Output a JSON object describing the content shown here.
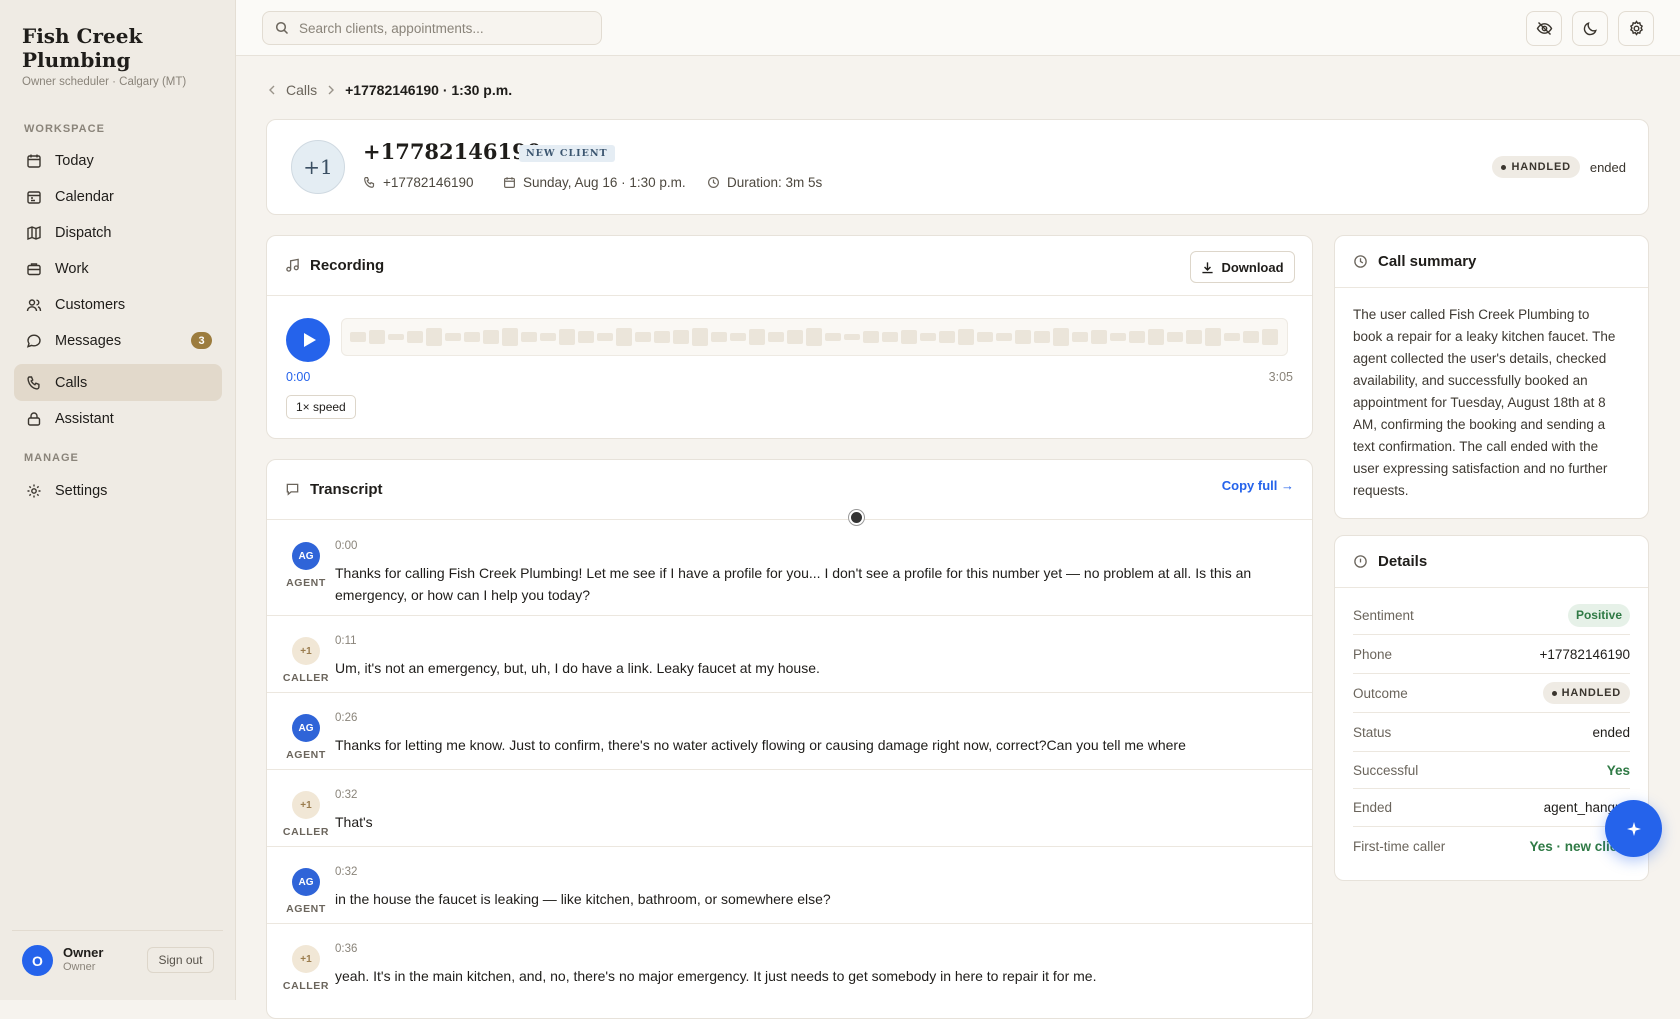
{
  "brand": {
    "name": "Fish Creek Plumbing",
    "subtitle": "Owner scheduler · Calgary (MT)"
  },
  "sidebar": {
    "workspace_label": "WORKSPACE",
    "manage_label": "MANAGE",
    "items": [
      {
        "label": "Today",
        "icon": "calendar-day-icon"
      },
      {
        "label": "Calendar",
        "icon": "calendar-icon"
      },
      {
        "label": "Dispatch",
        "icon": "map-icon"
      },
      {
        "label": "Work",
        "icon": "briefcase-icon"
      },
      {
        "label": "Customers",
        "icon": "users-icon"
      },
      {
        "label": "Messages",
        "icon": "message-icon",
        "badge": "3"
      },
      {
        "label": "Calls",
        "icon": "phone-icon",
        "active": true
      },
      {
        "label": "Assistant",
        "icon": "lock-icon"
      }
    ],
    "manage_items": [
      {
        "label": "Settings",
        "icon": "gear-icon"
      }
    ],
    "user": {
      "initial": "O",
      "name": "Owner",
      "role": "Owner",
      "signout": "Sign out"
    }
  },
  "topbar": {
    "search_placeholder": "Search clients, appointments..."
  },
  "breadcrumb": {
    "parent": "Calls",
    "current": "+17782146190 · 1:30 p.m."
  },
  "call": {
    "avatar": "+1",
    "number": "+17782146190",
    "badge": "NEW CLIENT",
    "phone": "+17782146190",
    "date": "Sunday, Aug 16 · 1:30 p.m.",
    "duration": "Duration: 3m 5s",
    "outcome": "HANDLED",
    "status": "ended"
  },
  "recording": {
    "title": "Recording",
    "download": "Download",
    "current_time": "0:00",
    "total_time": "3:05",
    "speed": "1× speed",
    "progress": 0
  },
  "transcript": {
    "title": "Transcript",
    "copy_label": "Copy full →",
    "turns": [
      {
        "role": "AGENT",
        "initials": "AG",
        "time": "0:00",
        "text": "Thanks for calling Fish Creek Plumbing! Let me see if I have a profile for you... I don't see a profile for this number yet — no problem at all. Is this an emergency, or how can I help you today?"
      },
      {
        "role": "CALLER",
        "initials": "+1",
        "time": "0:11",
        "text": "Um, it's not an emergency, but, uh, I do have a link. Leaky faucet at my house."
      },
      {
        "role": "AGENT",
        "initials": "AG",
        "time": "0:26",
        "text": "Thanks for letting me know. Just to confirm, there's no water actively flowing or causing damage right now, correct?Can you tell me where"
      },
      {
        "role": "CALLER",
        "initials": "+1",
        "time": "0:32",
        "text": "That's"
      },
      {
        "role": "AGENT",
        "initials": "AG",
        "time": "0:32",
        "text": "in the house the faucet is leaking — like kitchen, bathroom, or somewhere else?"
      },
      {
        "role": "CALLER",
        "initials": "+1",
        "time": "0:36",
        "text": "yeah. It's in the main kitchen, and, no, there's no major emergency. It just needs to get somebody in here to repair it for me."
      }
    ]
  },
  "summary": {
    "title": "Call summary",
    "text": "The user called Fish Creek Plumbing to book a repair for a leaky kitchen faucet. The agent collected the user's details, checked availability, and successfully booked an appointment for Tuesday, August 18th at 8 AM, confirming the booking and sending a text confirmation. The call ended with the user expressing satisfaction and no further requests."
  },
  "details": {
    "title": "Details",
    "sentiment_label": "Sentiment",
    "sentiment": "Positive",
    "phone_label": "Phone",
    "phone": "+17782146190",
    "outcome_label": "Outcome",
    "outcome": "HANDLED",
    "status_label": "Status",
    "status": "ended",
    "successful_label": "Successful",
    "successful": "Yes",
    "ended_label": "Ended",
    "ended": "agent_hangup",
    "first_time_label": "First-time caller",
    "first_time": "Yes · new client"
  },
  "colors": {
    "accent": "#2563eb",
    "sidebar_bg": "#efebe4",
    "active_nav": "#e2d9cb",
    "badge": "#9c7c3e",
    "positive": "#2f7a45"
  }
}
